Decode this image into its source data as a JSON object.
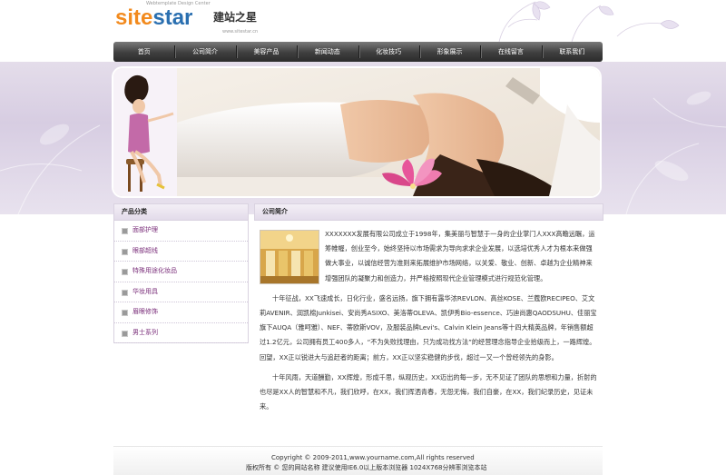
{
  "header": {
    "logo_site": "site",
    "logo_star": "star",
    "logo_cn": "建站之星",
    "logo_sub": "Webtemplate Design Center",
    "logo_url": "www.sitestar.cn"
  },
  "nav": {
    "items": [
      "首页",
      "公司简介",
      "美容产品",
      "新闻动态",
      "化妆技巧",
      "形象展示",
      "在线留言",
      "联系我们"
    ]
  },
  "sidebar": {
    "title": "产品分类",
    "items": [
      "面部护理",
      "眼部超线",
      "特殊用途化妆品",
      "华妆用具",
      "眉眼修饰",
      "男士系列"
    ]
  },
  "content": {
    "title": "公司简介",
    "paragraphs": [
      "XXXXXXX发展有限公司成立于1998年，集美丽与智慧于一身的企业掌门人XXX高瞻远瞩，运筹帷幄，创业至今，始终坚持以市场需求为导向求求企业发展，以选培优秀人才为根本来做强做大事业，以诚信经营为准则来拓展维护市场网络，以关爱、敬业、创新、卓越为企业精神来增强团队的凝聚力和创造力，并严格按照现代企业管理模式进行规范化管理。",
      "十年征战，XX飞速成长，日化行业，盛名远扬，旗下拥有露华浓REVLON、高丝KOSE、兰蔻欧RECIPEO、艾文莉AVENIR、润凯棉Junkisei、安尚秀ASIXO、美洛蒂OLEVA、凯伊秀Bio-essence、巧迪尚惠QAODSUHU、佳丽宝旗下AUQA（雅呵雅）、NEF、蒂欧斯VOV，及服装品牌Levi's、Calvin Klein Jeans等十四大精英品牌，年销售额超过1.2亿元，公司拥有员工400多人，“不为失败找理由，只为成功找方法”的经营理念指导企业拾级而上，一路辉煌。回望，XX正以锐进大与追赶者的距离；前方，XX正以坚实稳健的步伐，超过一又一个曾经领先的身影。",
      "十年风雨，天道酬勤，XX辉煌，形成千思，纵观历史，XX迈出的每一步，无不见证了团队的思想和力量，折射的也尽是XX人的智慧和不凡，我们欣呼，在XX，我们挥洒青春，无怨无悔，我们自豪，在XX，我们纪录历史，见证未来。"
    ]
  },
  "footer": {
    "copyright": "Copyright © 2009-2011,www.yourname.com,All rights reserved",
    "info": "版权所有 © 您的网站名称  建议使用IE6.0以上版本浏览器 1024X768分辨率浏览本站"
  },
  "colors": {
    "accent_purple": "#7a2e7a",
    "band": "#d7cde2",
    "nav_dark": "#2c2c2c"
  }
}
